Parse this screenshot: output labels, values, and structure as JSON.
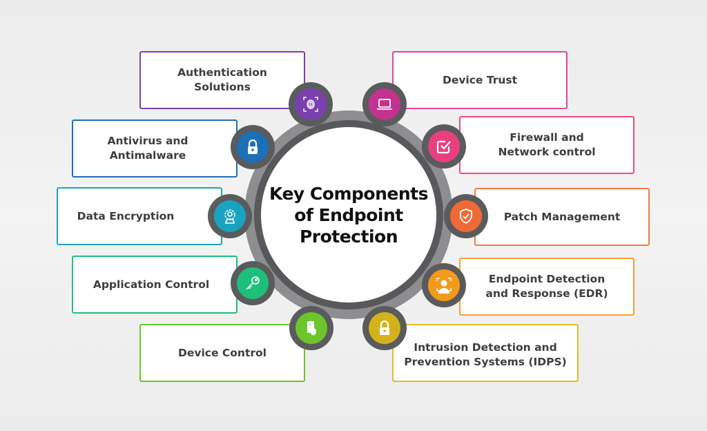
{
  "center": {
    "title": "Key Components\nof Endpoint\nProtection"
  },
  "components": [
    {
      "label": "Authentication\nSolutions",
      "icon": "fingerprint-icon",
      "color": "#7b3fb0"
    },
    {
      "label": "Antivirus and\nAntimalware",
      "icon": "lock-icon",
      "color": "#1d6fb8"
    },
    {
      "label": "Data Encryption",
      "icon": "user-gear-icon",
      "color": "#1aa3c0"
    },
    {
      "label": "Application Control",
      "icon": "key-icon",
      "color": "#1dbf7a"
    },
    {
      "label": "Device Control",
      "icon": "phone-hand-icon",
      "color": "#6cc52b"
    },
    {
      "label": "Device Trust",
      "icon": "laptop-icon",
      "color": "#c2328f"
    },
    {
      "label": "Firewall and\nNetwork control",
      "icon": "checkbox-icon",
      "color": "#e8407f"
    },
    {
      "label": "Patch Management",
      "icon": "shield-check-icon",
      "color": "#ef6a34"
    },
    {
      "label": "Endpoint Detection\nand Response (EDR)",
      "icon": "face-scan-icon",
      "color": "#f39a1b"
    },
    {
      "label": "Intrusion Detection and\nPrevention Systems (IDPS)",
      "icon": "padlock-icon",
      "color": "#d4b21c"
    }
  ]
}
